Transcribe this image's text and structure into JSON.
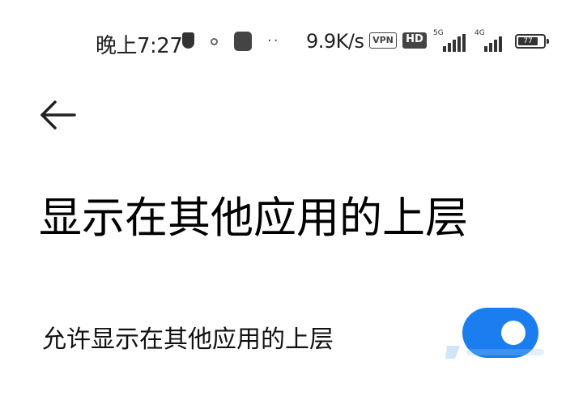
{
  "status_bar": {
    "time": "晚上7:27",
    "net_speed": "9.9K/s",
    "vpn_label": "VPN",
    "hd_label": "HD",
    "net_type_1": "5G",
    "net_type_2": "4G",
    "battery_level": "77",
    "icons": [
      "shield-icon",
      "location-dot-icon",
      "app-notification-icon",
      "more-dots-icon",
      "signal-icon",
      "battery-icon"
    ]
  },
  "header": {
    "back_icon": "arrow-left-icon",
    "title": "显示在其他应用的上层"
  },
  "settings": [
    {
      "label": "允许显示在其他应用的上层",
      "enabled": true
    }
  ],
  "colors": {
    "toggle_on": "#1a7ef0",
    "background": "#ffffff"
  }
}
